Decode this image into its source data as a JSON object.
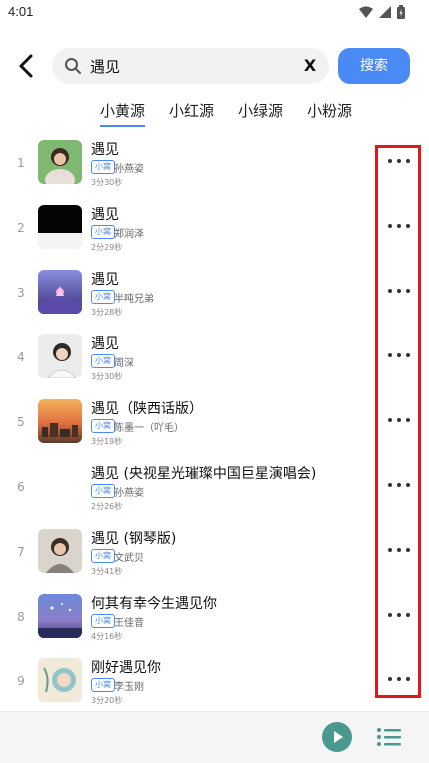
{
  "status_bar": {
    "time": "4:01"
  },
  "search": {
    "query": "遇见",
    "clear_label": "X",
    "button_label": "搜索"
  },
  "tabs": [
    {
      "label": "小黄源",
      "active": true
    },
    {
      "label": "小红源",
      "active": false
    },
    {
      "label": "小绿源",
      "active": false
    },
    {
      "label": "小粉源",
      "active": false
    }
  ],
  "source_badge": "小窝",
  "songs": [
    {
      "index": "1",
      "title": "遇见",
      "artist": "孙燕姿",
      "duration": "3分30秒",
      "cover": "portrait-cover"
    },
    {
      "index": "2",
      "title": "遇见",
      "artist": "郑润泽",
      "duration": "2分29秒",
      "cover": "black-cover"
    },
    {
      "index": "3",
      "title": "遇见",
      "artist": "半吨兄弟",
      "duration": "3分28秒",
      "cover": "purple-sky-cover"
    },
    {
      "index": "4",
      "title": "遇见",
      "artist": "周深",
      "duration": "3分30秒",
      "cover": "portrait-cover"
    },
    {
      "index": "5",
      "title": "遇见（陕西话版）",
      "artist": "陈墨一（吖毛）",
      "duration": "3分19秒",
      "cover": "sunset-city-cover"
    },
    {
      "index": "6",
      "title": "遇见 (央视星光璀璨中国巨星演唱会)",
      "artist": "孙燕姿",
      "duration": "2分26秒",
      "cover": ""
    },
    {
      "index": "7",
      "title": "遇见 (钢琴版)",
      "artist": "文武贝",
      "duration": "3分41秒",
      "cover": "portrait-cover"
    },
    {
      "index": "8",
      "title": "何其有幸今生遇见你",
      "artist": "王佳音",
      "duration": "4分16秒",
      "cover": "blue-sky-cover"
    },
    {
      "index": "9",
      "title": "刚好遇见你",
      "artist": "李玉刚",
      "duration": "3分20秒",
      "cover": "illustration-cover"
    }
  ],
  "colors": {
    "accent": "#4a8af4",
    "highlight": "#e01818",
    "play": "#4a9990"
  }
}
